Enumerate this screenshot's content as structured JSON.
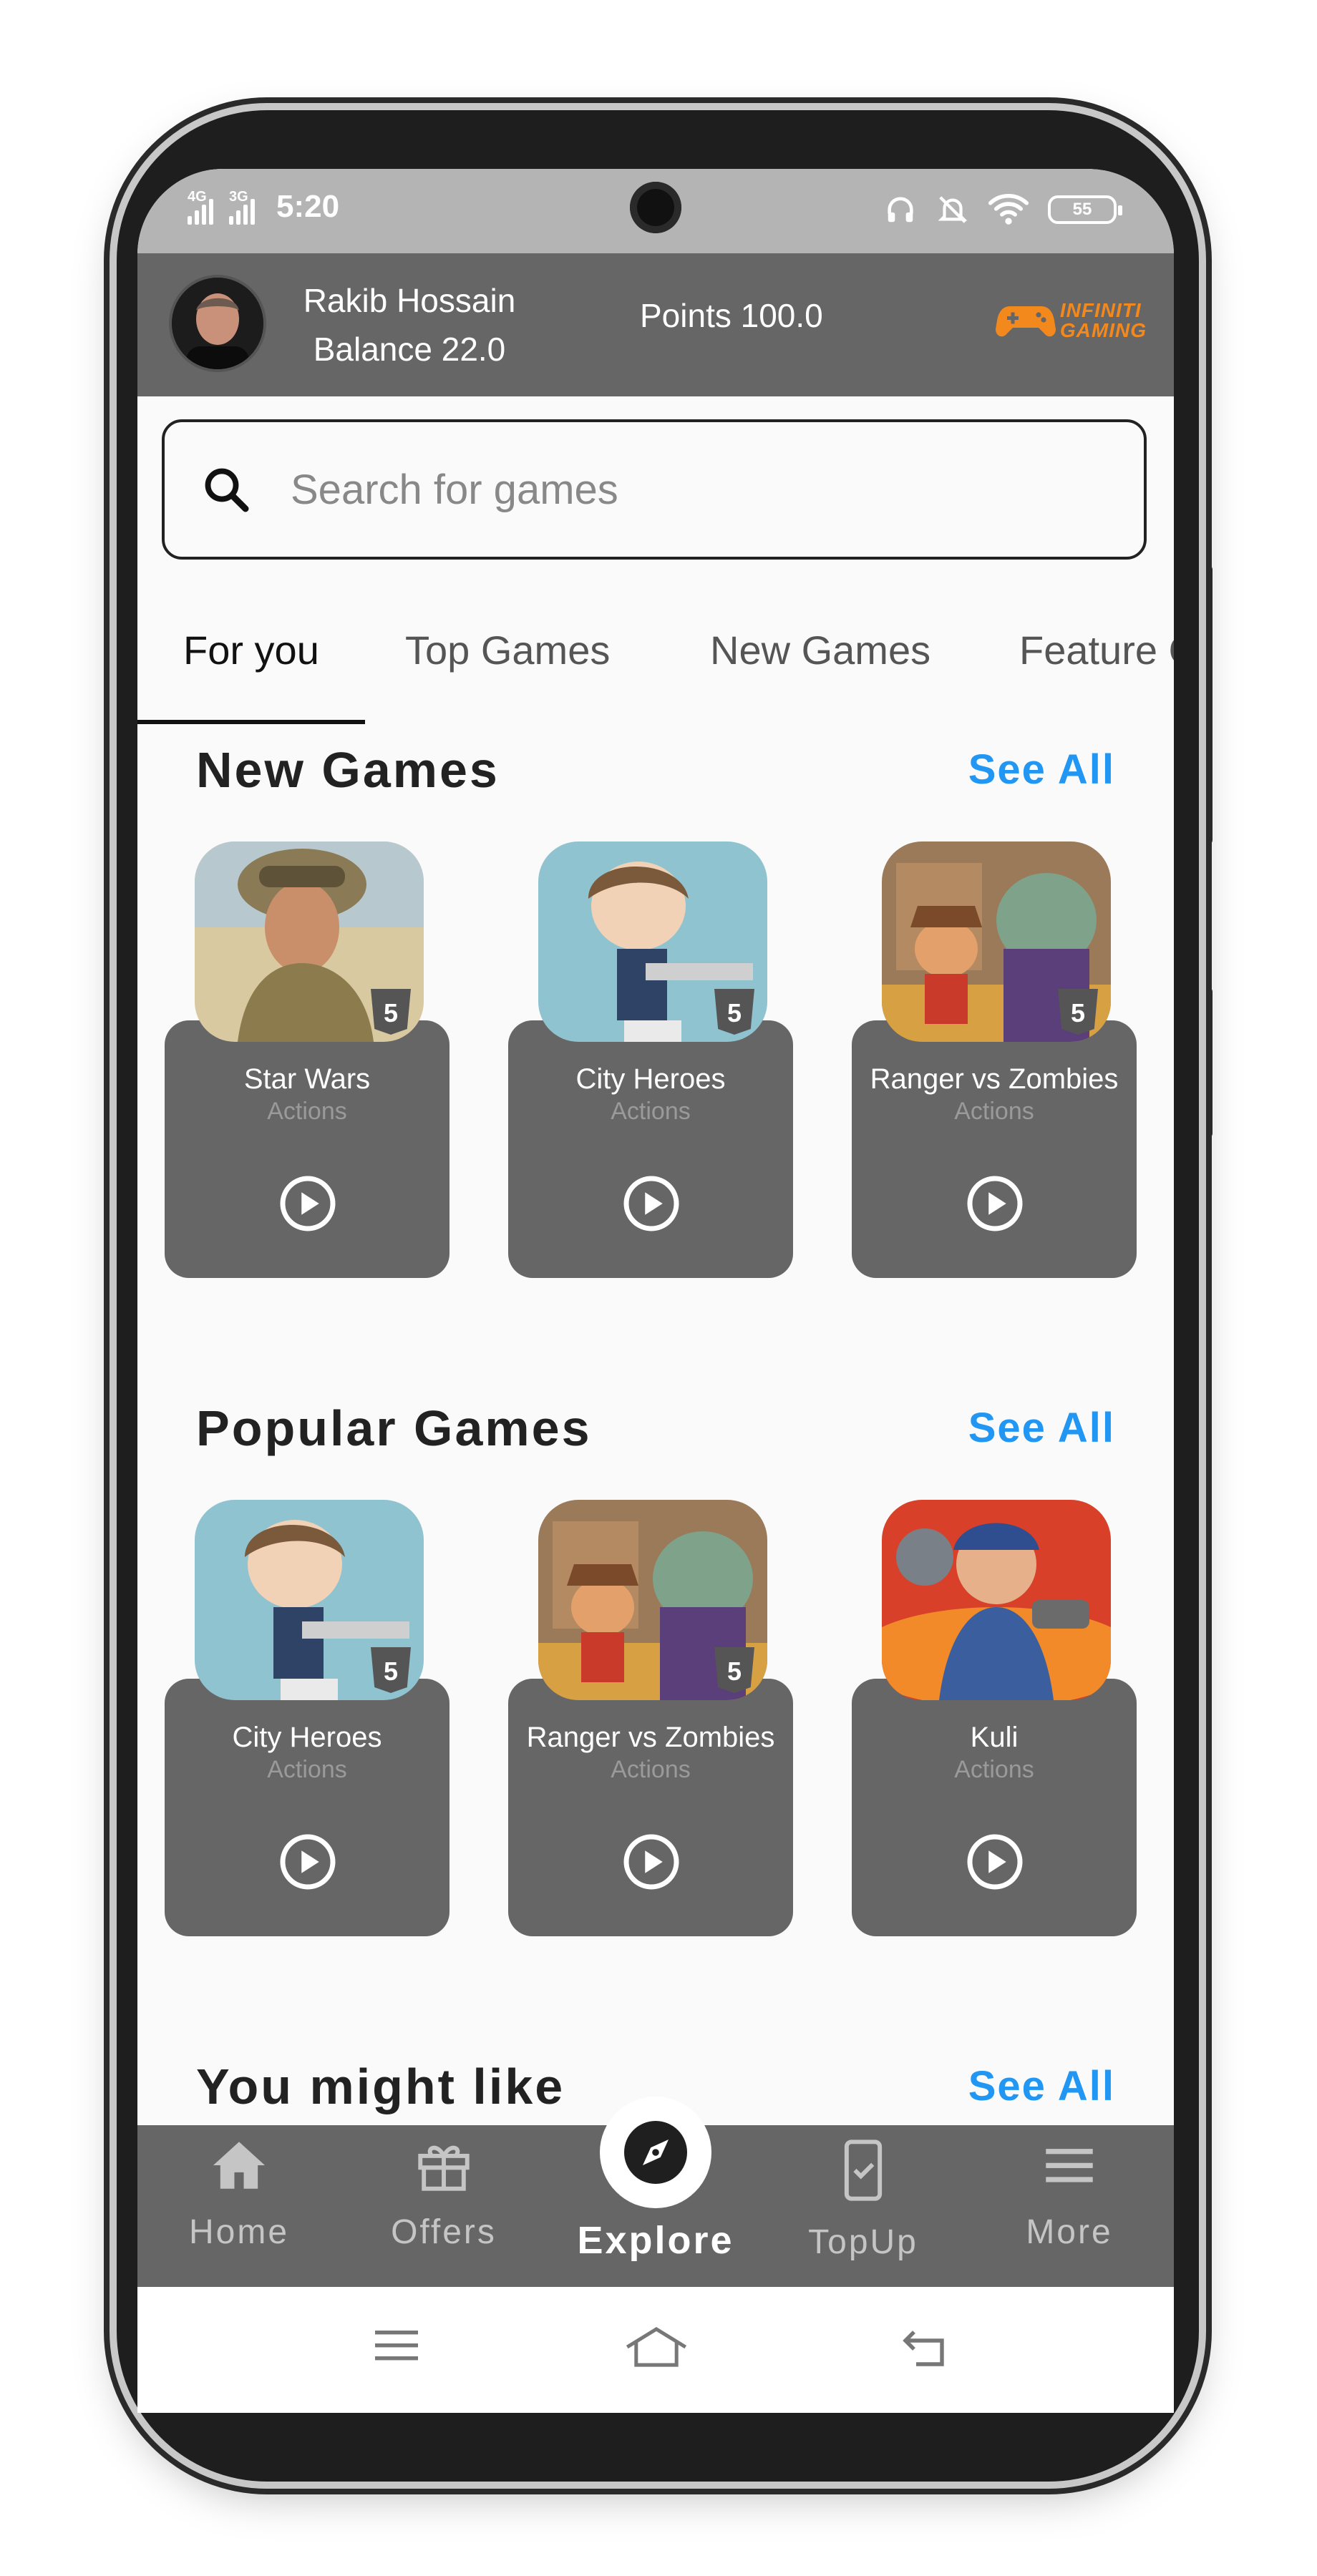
{
  "status_bar": {
    "network_1": "4G",
    "network_2": "3G",
    "time": "5:20",
    "battery": "55"
  },
  "header": {
    "user_name": "Rakib Hossain",
    "balance": "Balance 22.0",
    "points": "Points 100.0",
    "brand_line_1": "INFINITI",
    "brand_line_2": "GAMING"
  },
  "search": {
    "placeholder": "Search for games",
    "value": ""
  },
  "tabs": [
    {
      "label": "For you",
      "active": true
    },
    {
      "label": "Top Games",
      "active": false
    },
    {
      "label": "New Games",
      "active": false
    },
    {
      "label": "Feature G",
      "active": false
    }
  ],
  "sections": {
    "new_games": {
      "title": "New Games",
      "see_all": "See All",
      "games": [
        {
          "name": "Star Wars",
          "category": "Actions",
          "icon": "html5-badge"
        },
        {
          "name": "City Heroes",
          "category": "Actions",
          "icon": "html5-badge"
        },
        {
          "name": "Ranger vs Zombies",
          "category": "Actions",
          "icon": "html5-badge"
        }
      ]
    },
    "popular_games": {
      "title": "Popular Games",
      "see_all": "See All",
      "games": [
        {
          "name": "City Heroes",
          "category": "Actions",
          "icon": "html5-badge"
        },
        {
          "name": "Ranger vs Zombies",
          "category": "Actions",
          "icon": "html5-badge"
        },
        {
          "name": "Kuli",
          "category": "Actions",
          "icon": ""
        }
      ]
    },
    "you_might_like": {
      "title": "You might like",
      "see_all": "See All"
    }
  },
  "bottom_nav": {
    "home": "Home",
    "offers": "Offers",
    "explore": "Explore",
    "topup": "TopUp",
    "more": "More",
    "active": "Explore"
  },
  "colors": {
    "header_bg": "#666666",
    "accent": "#2196f3",
    "brand": "#f3891c",
    "card_bg": "#666666"
  }
}
